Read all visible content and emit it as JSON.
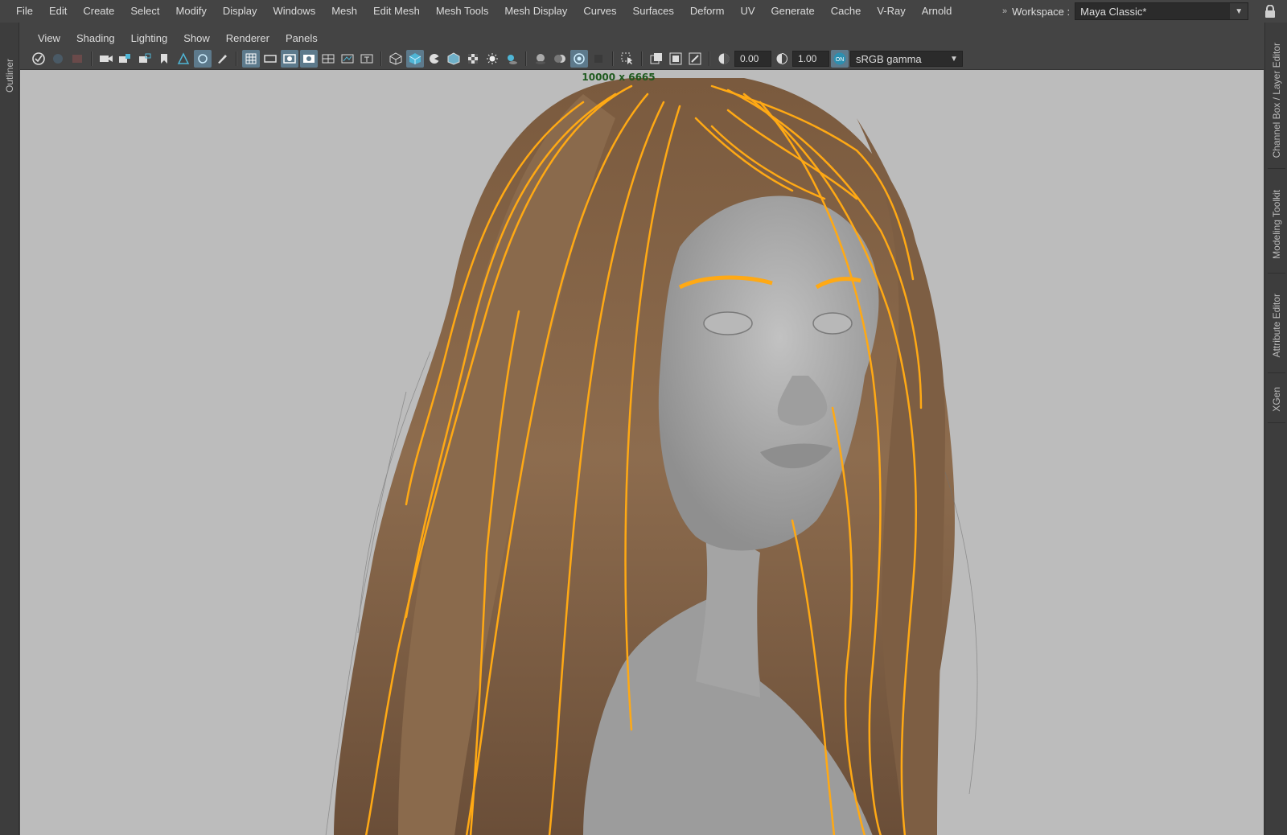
{
  "menubar": {
    "items": [
      "File",
      "Edit",
      "Create",
      "Select",
      "Modify",
      "Display",
      "Windows",
      "Mesh",
      "Edit Mesh",
      "Mesh Tools",
      "Mesh Display",
      "Curves",
      "Surfaces",
      "Deform",
      "UV",
      "Generate",
      "Cache",
      "V-Ray",
      "Arnold"
    ]
  },
  "workspace": {
    "arrows": "»",
    "label": "Workspace :",
    "value": "Maya Classic*"
  },
  "left_tabs": [
    "Outliner"
  ],
  "right_tabs": [
    "Channel Box / Layer Editor",
    "Modeling Toolkit",
    "Attribute Editor",
    "XGen"
  ],
  "panel": {
    "menu": [
      "View",
      "Shading",
      "Lighting",
      "Show",
      "Renderer",
      "Panels"
    ],
    "toolbar": {
      "exposure": "0.00",
      "gamma": "1.00",
      "color_space": "sRGB gamma"
    }
  },
  "viewport": {
    "resolution": "10000 x 6665",
    "colors": {
      "background": "#bcbcbc",
      "guide_curves": "#ffa914",
      "hair": "#8a6a4c",
      "mesh": "#a6a6a6"
    }
  }
}
